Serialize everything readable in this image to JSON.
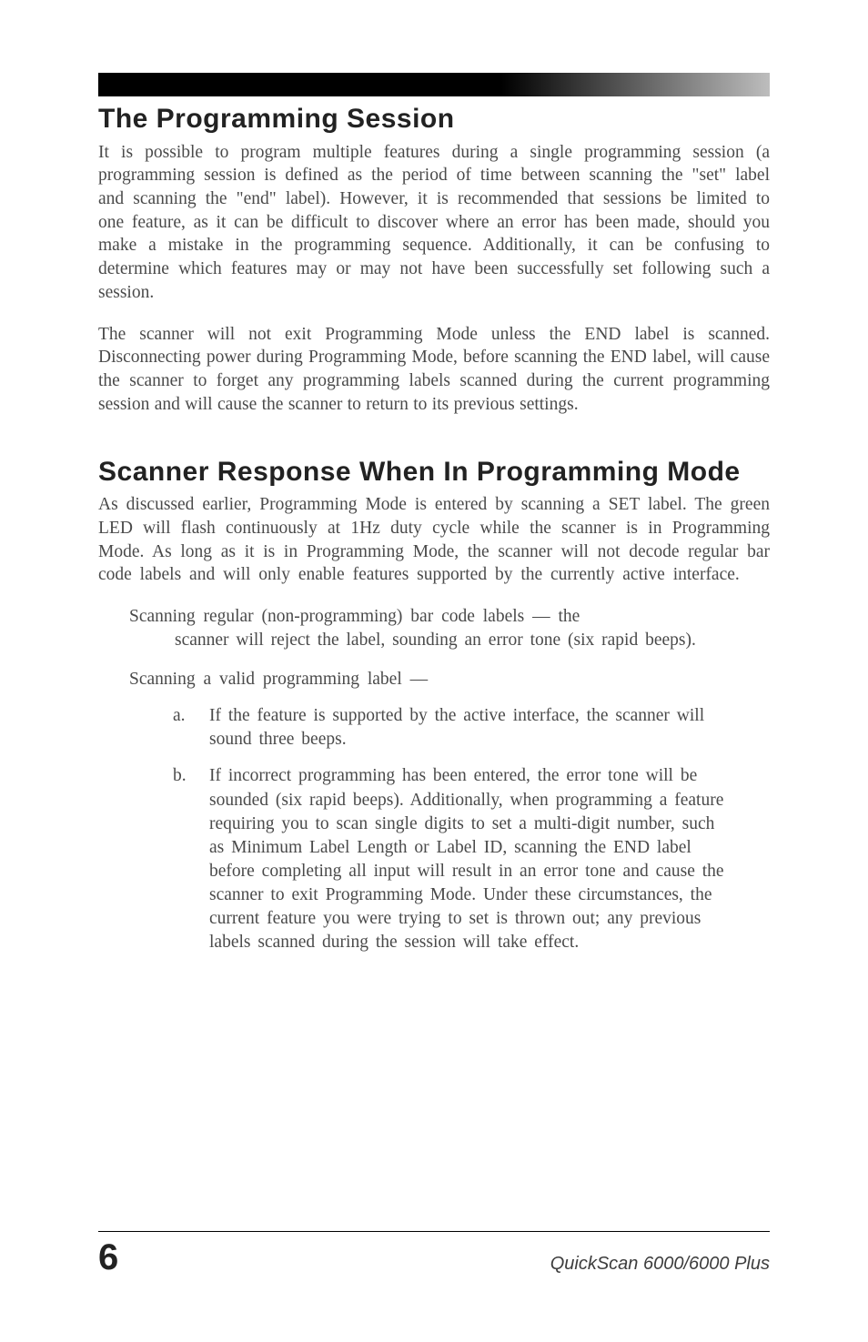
{
  "topbar": "",
  "section1": {
    "heading": "The Programming Session",
    "para1": "It is possible to program multiple features during a single programming session (a programming session is defined as the period of time between scanning the \"set\" label and scanning the \"end\" label).  However, it is recommended that sessions be limited to one feature, as it can be difficult to discover where an error has been made, should you make a mistake in the programming sequence.  Additionally, it can be confusing to determine which features may or may not have been successfully set following such a session.",
    "para2": "The scanner will not exit Programming Mode unless the END label is scanned.  Disconnecting power during Programming Mode, before scanning the END label, will cause the scanner to forget any programming labels scanned during the current programming session and will cause the scanner to return to its previous settings."
  },
  "section2": {
    "heading": "Scanner Response When In Programming Mode",
    "para1": "As discussed earlier, Programming Mode is entered by scanning a SET label.  The green LED will flash continuously at 1Hz duty cycle while the scanner is in Programming Mode.  As long as it is in Programming Mode, the scanner will not decode regular bar code labels and will only enable features supported by the currently active interface.",
    "scan1_line1": "Scanning regular (non-programming) bar code labels  —  the",
    "scan1_rest": "scanner will reject the label, sounding an error tone (six rapid beeps).",
    "scan2": "Scanning a valid programming label  —",
    "items": {
      "a_marker": "a.",
      "a_text": "If the feature is supported by the active interface, the scanner will sound three beeps.",
      "b_marker": "b.",
      "b_text": "If incorrect programming has been entered, the error tone will be sounded (six rapid beeps).  Additionally, when programming a feature requiring you to scan single digits to set a multi-digit number, such as Minimum Label Length or Label ID, scanning the END label before completing all input will result in an error tone and cause the scanner to exit Programming Mode.  Under these circumstances, the current feature you were trying to set is thrown out; any previous labels scanned during the session will take effect."
    }
  },
  "footer": {
    "page": "6",
    "product": "QuickScan 6000/6000 Plus"
  }
}
